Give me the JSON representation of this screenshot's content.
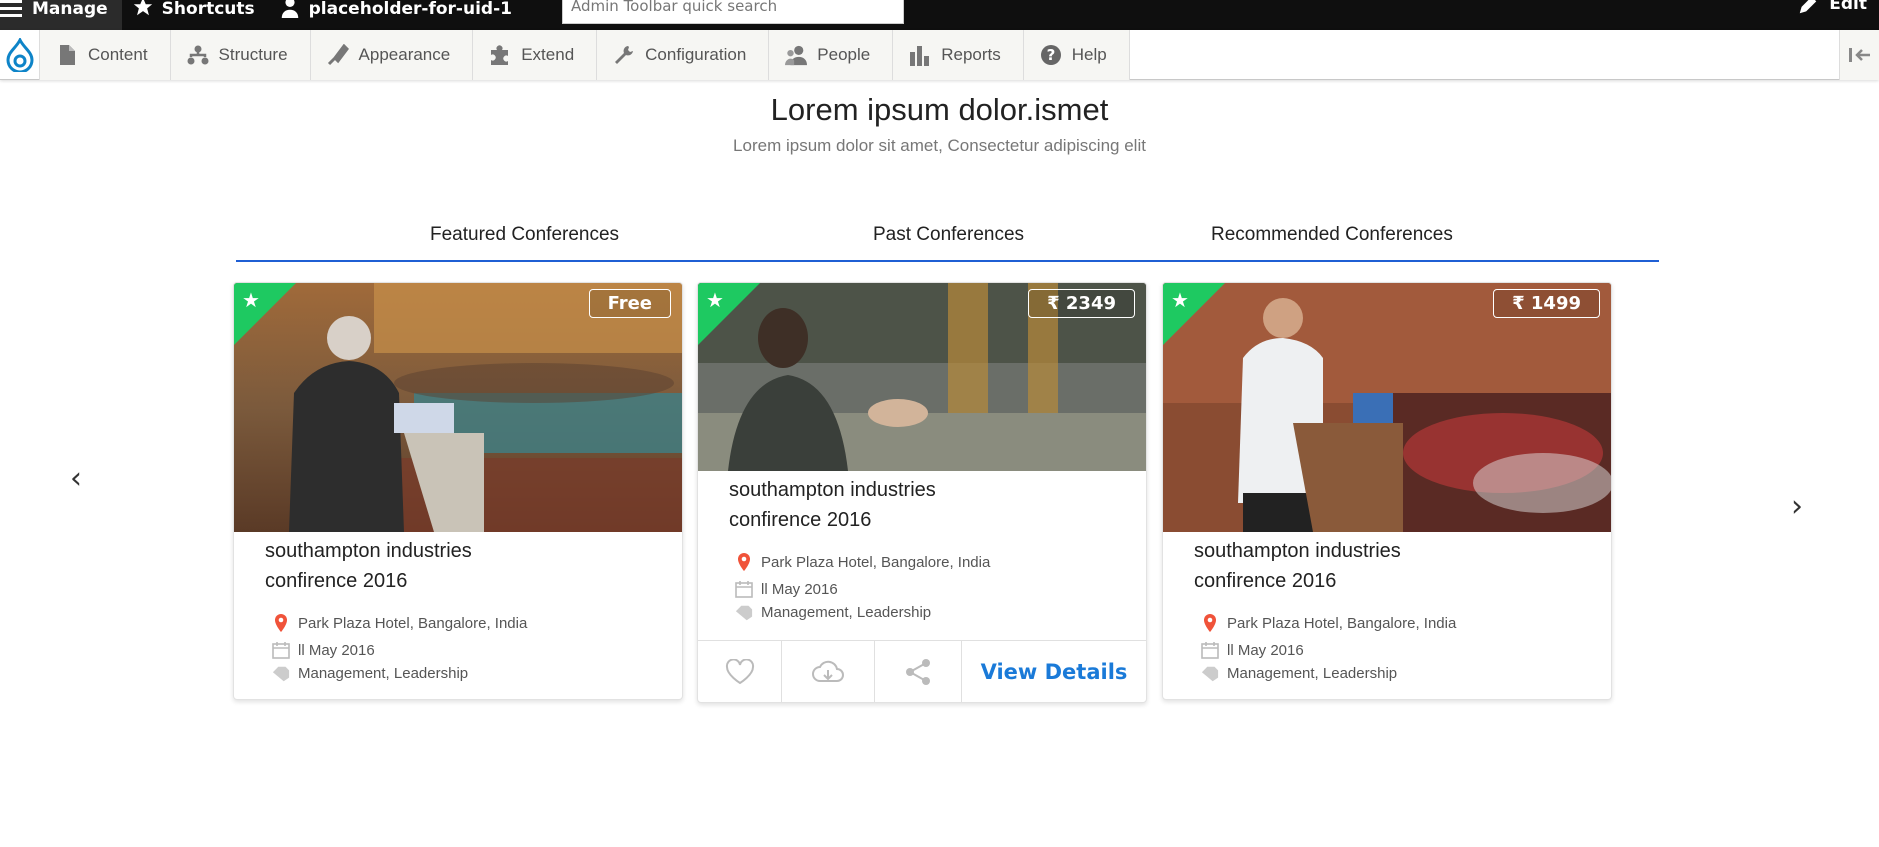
{
  "admin_bar": {
    "manage": "Manage",
    "shortcuts": "Shortcuts",
    "user": "placeholder-for-uid-1",
    "search_placeholder": "Admin Toolbar quick search",
    "edit": "Edit"
  },
  "toolbar": {
    "items": [
      {
        "label": "Content",
        "icon": "page-icon"
      },
      {
        "label": "Structure",
        "icon": "hierarchy-icon"
      },
      {
        "label": "Appearance",
        "icon": "brush-icon"
      },
      {
        "label": "Extend",
        "icon": "puzzle-icon"
      },
      {
        "label": "Configuration",
        "icon": "wrench-icon"
      },
      {
        "label": "People",
        "icon": "people-icon"
      },
      {
        "label": "Reports",
        "icon": "bar-chart-icon"
      },
      {
        "label": "Help",
        "icon": "help-icon"
      }
    ]
  },
  "header": {
    "title": "Lorem ipsum dolor.ismet",
    "subtitle": "Lorem ipsum dolor sit amet, Consectetur adipiscing elit"
  },
  "tabs": [
    "Featured Conferences",
    "Past Conferences",
    "Recommended Conferences"
  ],
  "colors": {
    "accent_blue": "#1f5fd4",
    "ribbon_green": "#1ec961",
    "pin_red": "#f0533a",
    "link_blue": "#1a7ad8"
  },
  "cards": [
    {
      "price": "Free",
      "title_line1": "southampton industries",
      "title_line2": "confirence 2016",
      "location": "Park Plaza Hotel, Bangalore, India",
      "date": "ll May 2016",
      "tags": "Management, Leadership"
    },
    {
      "price": "₹ 2349",
      "title_line1": "southampton industries",
      "title_line2": "confirence 2016",
      "location": "Park Plaza Hotel, Bangalore, India",
      "date": "ll May 2016",
      "tags": "Management, Leadership",
      "view_details": "View Details"
    },
    {
      "price": "₹ 1499",
      "title_line1": "southampton industries",
      "title_line2": "confirence 2016",
      "location": "Park Plaza Hotel, Bangalore, India",
      "date": "ll May 2016",
      "tags": "Management, Leadership"
    }
  ]
}
